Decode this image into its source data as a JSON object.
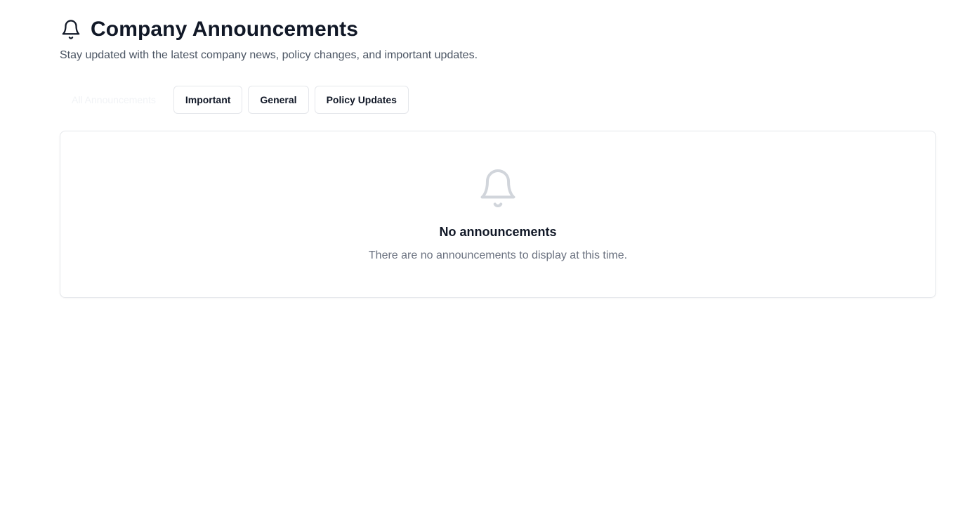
{
  "header": {
    "icon": "bell-icon",
    "title": "Company Announcements",
    "subtitle": "Stay updated with the latest company news, policy changes, and important updates."
  },
  "tabs": [
    {
      "label": "All Announcements",
      "active": true
    },
    {
      "label": "Important",
      "active": false
    },
    {
      "label": "General",
      "active": false
    },
    {
      "label": "Policy Updates",
      "active": false
    }
  ],
  "empty_state": {
    "icon": "bell-icon",
    "title": "No announcements",
    "description": "There are no announcements to display at this time."
  },
  "colors": {
    "title": "#111827",
    "muted_text": "#6b7280",
    "border": "#e5e7eb",
    "empty_icon": "#d1d5db"
  }
}
